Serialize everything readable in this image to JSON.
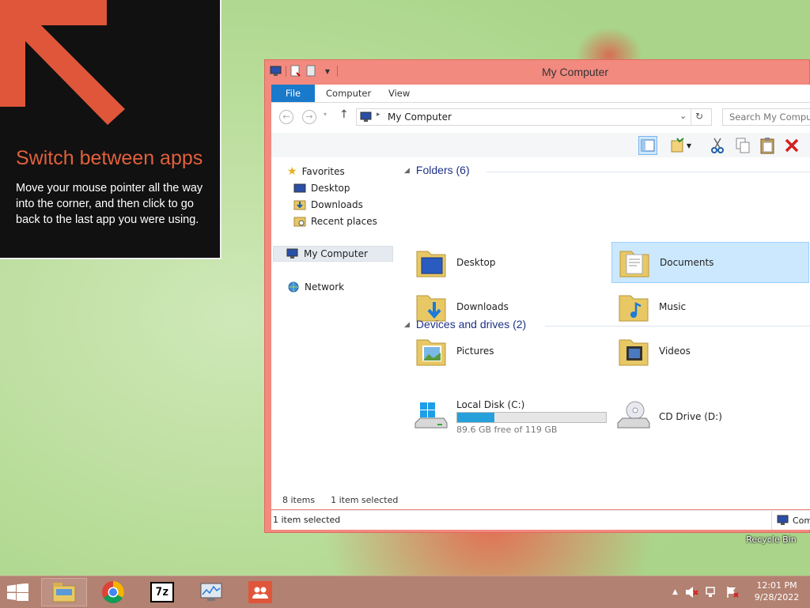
{
  "tip": {
    "title": "Switch between apps",
    "body": "Move your mouse pointer all the way into the corner, and then click to go back to the last app you were using."
  },
  "window": {
    "title": "My Computer",
    "ribbon_tabs": [
      "File",
      "Computer",
      "View"
    ],
    "address": "My Computer",
    "search_placeholder": "Search My Computer"
  },
  "nav_pane": {
    "favorites": "Favorites",
    "favorites_items": [
      "Desktop",
      "Downloads",
      "Recent places"
    ],
    "my_computer": "My Computer",
    "network": "Network"
  },
  "main": {
    "folders_header": "Folders (6)",
    "folders": [
      {
        "label": "Desktop",
        "icon": "desktop-folder-icon",
        "selected": false
      },
      {
        "label": "Documents",
        "icon": "documents-folder-icon",
        "selected": true
      },
      {
        "label": "Downloads",
        "icon": "downloads-folder-icon",
        "selected": false
      },
      {
        "label": "Music",
        "icon": "music-folder-icon",
        "selected": false
      },
      {
        "label": "Pictures",
        "icon": "pictures-folder-icon",
        "selected": false
      },
      {
        "label": "Videos",
        "icon": "videos-folder-icon",
        "selected": false
      }
    ],
    "devices_header": "Devices and drives (2)",
    "drives": [
      {
        "label": "Local Disk (C:)",
        "free": "89.6 GB free of 119 GB",
        "used_fraction": 0.25
      },
      {
        "label": "CD Drive (D:)"
      }
    ],
    "item_count": "8 items",
    "selected_count": "1 item selected"
  },
  "statusbar": {
    "left": "1 item selected",
    "right": "Computer"
  },
  "desktop": {
    "recycle_bin": "Recycle Bin"
  },
  "taskbar": {
    "apps": [
      "file-explorer-icon",
      "chrome-icon",
      "7zip-icon",
      "resource-monitor-icon",
      "people-icon"
    ],
    "seven_zip_text": "7z",
    "time": "12:01 PM",
    "date": "9/28/2022"
  },
  "colors": {
    "window_frame": "#f28a80",
    "accent": "#1979ca",
    "tip_title": "#e0603c",
    "taskbar": "#b38171"
  }
}
